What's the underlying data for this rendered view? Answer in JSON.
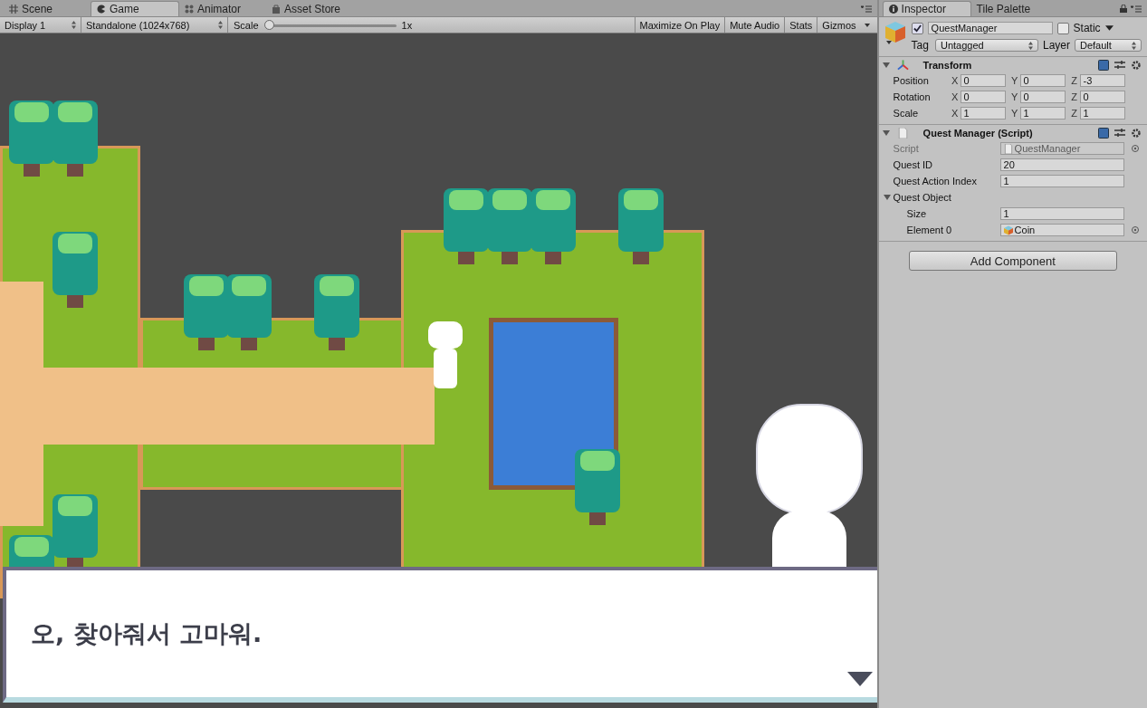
{
  "tabs": [
    {
      "label": "Scene",
      "selected": false
    },
    {
      "label": "Game",
      "selected": true
    },
    {
      "label": "Animator",
      "selected": false
    },
    {
      "label": "Asset Store",
      "selected": false
    }
  ],
  "game_toolbar": {
    "display": "Display 1",
    "resolution": "Standalone (1024x768)",
    "scale_label": "Scale",
    "scale": {
      "level": 0,
      "reading": "1x"
    },
    "toggles": [
      {
        "label": "Maximize On Play",
        "on": false
      },
      {
        "label": "Mute Audio",
        "on": false
      },
      {
        "label": "Stats",
        "on": false
      }
    ],
    "gizmos": "Gizmos"
  },
  "dialog": {
    "text": "오, 찾아줘서 고마워."
  },
  "inspector": {
    "tabs": [
      {
        "label": "Inspector",
        "selected": true
      },
      {
        "label": "Tile Palette",
        "selected": false
      }
    ],
    "object": {
      "active": true,
      "name": "QuestManager",
      "static_label": "Static",
      "static": false,
      "tag_label": "Tag",
      "tag": "Untagged",
      "layer_label": "Layer",
      "layer": "Default"
    },
    "transform": {
      "title": "Transform",
      "expanded": true,
      "rows": [
        {
          "label": "Position",
          "values": [
            {
              "axis": "X",
              "value": "0"
            },
            {
              "axis": "Y",
              "value": "0"
            },
            {
              "axis": "Z",
              "value": "-3"
            }
          ]
        },
        {
          "label": "Rotation",
          "values": [
            {
              "axis": "X",
              "value": "0"
            },
            {
              "axis": "Y",
              "value": "0"
            },
            {
              "axis": "Z",
              "value": "0"
            }
          ]
        },
        {
          "label": "Scale",
          "values": [
            {
              "axis": "X",
              "value": "1"
            },
            {
              "axis": "Y",
              "value": "1"
            },
            {
              "axis": "Z",
              "value": "1"
            }
          ]
        }
      ]
    },
    "script": {
      "title": "Quest Manager (Script)",
      "expanded": true,
      "fields": [
        {
          "kind": "object",
          "label": "Script",
          "value": "QuestManager",
          "disabled": true
        },
        {
          "kind": "text",
          "label": "Quest ID",
          "value": "20",
          "disabled": false
        },
        {
          "kind": "text",
          "label": "Quest Action Index",
          "value": "1",
          "disabled": false
        },
        {
          "kind": "foldout",
          "label": "Quest Object",
          "expanded": true,
          "children": [
            {
              "kind": "text",
              "label": "Size",
              "value": "1",
              "disabled": false
            },
            {
              "kind": "object",
              "label": "Element 0",
              "value": "Coin",
              "disabled": false
            }
          ]
        }
      ]
    },
    "add_component": "Add Component"
  }
}
